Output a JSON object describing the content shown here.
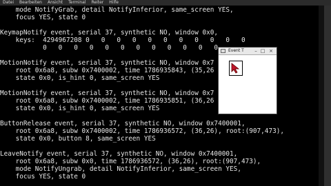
{
  "menubar": {
    "items": [
      "Datei",
      "Bearbeiten",
      "Ansicht",
      "Terminal",
      "Reiter",
      "Hilfe"
    ]
  },
  "terminal": {
    "lines": [
      "    mode NotifyGrab, detail NotifyInferior, same_screen YES,",
      "    focus YES, state 0",
      "",
      "KeymapNotify event, serial 37, synthetic NO, window 0x0,",
      "    keys:  4294967208 0   0   0   0   0   0   0   0   0   0   0",
      "           0   0   0   0   0   0   0   0   0   0   0   0",
      "",
      "MotionNotify event, serial 37, synthetic NO, window 0x7",
      "    root 0x6a8, subw 0x7400002, time 1786935843, (35,26",
      "    state 0x0, is_hint 0, same_screen YES",
      "",
      "MotionNotify event, serial 37, synthetic NO, window 0x7",
      "    root 0x6a8, subw 0x7400002, time 1786935851, (36,26",
      "    state 0x0, is_hint 0, same_screen YES",
      "",
      "ButtonRelease event, serial 37, synthetic NO, window 0x7400001,",
      "    root 0x6a8, subw 0x7400002, time 1786936572, (36,26), root:(907,473),",
      "    state 0x0, button 8, same_screen YES",
      "",
      "LeaveNotify event, serial 37, synthetic NO, window 0x7400001,",
      "    root 0x6a8, subw 0x0, time 1786936572, (36,26), root:(907,473),",
      "    mode NotifyUngrab, detail NotifyInferior, same_screen YES,",
      "    focus YES, state 0"
    ]
  },
  "xev_window": {
    "title": "Event T"
  }
}
